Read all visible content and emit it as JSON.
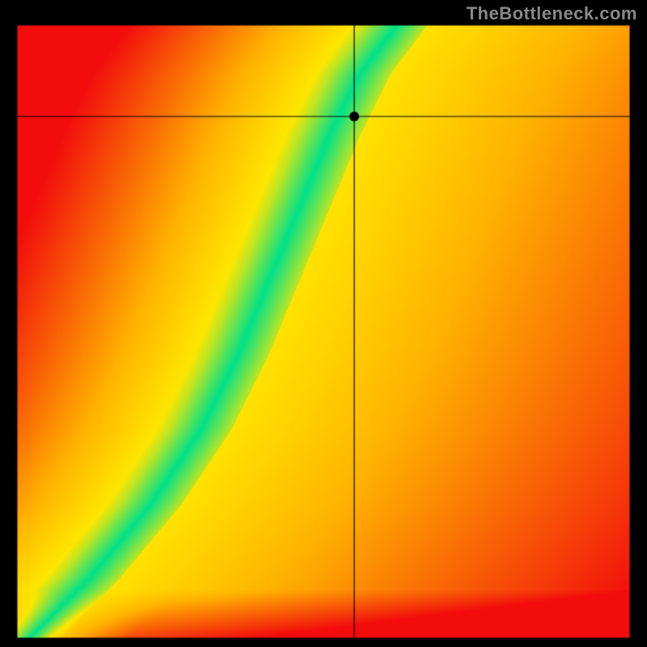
{
  "watermark": "TheBottleneck.com",
  "chart_data": {
    "type": "heatmap",
    "title": "",
    "xlabel": "",
    "ylabel": "",
    "xlim": [
      0,
      1
    ],
    "ylim": [
      0,
      1
    ],
    "marker": {
      "x": 0.55,
      "y": 0.85
    },
    "colormap": [
      "#f20c0c",
      "#ffb400",
      "#ffe600",
      "#00e18a"
    ],
    "curve_points": [
      {
        "x": 0.02,
        "y": 0.0
      },
      {
        "x": 0.12,
        "y": 0.1
      },
      {
        "x": 0.22,
        "y": 0.22
      },
      {
        "x": 0.3,
        "y": 0.34
      },
      {
        "x": 0.36,
        "y": 0.46
      },
      {
        "x": 0.41,
        "y": 0.58
      },
      {
        "x": 0.46,
        "y": 0.7
      },
      {
        "x": 0.51,
        "y": 0.82
      },
      {
        "x": 0.56,
        "y": 0.92
      },
      {
        "x": 0.62,
        "y": 1.0
      }
    ],
    "band_half_width": 0.05,
    "grid": false,
    "legend": false
  }
}
